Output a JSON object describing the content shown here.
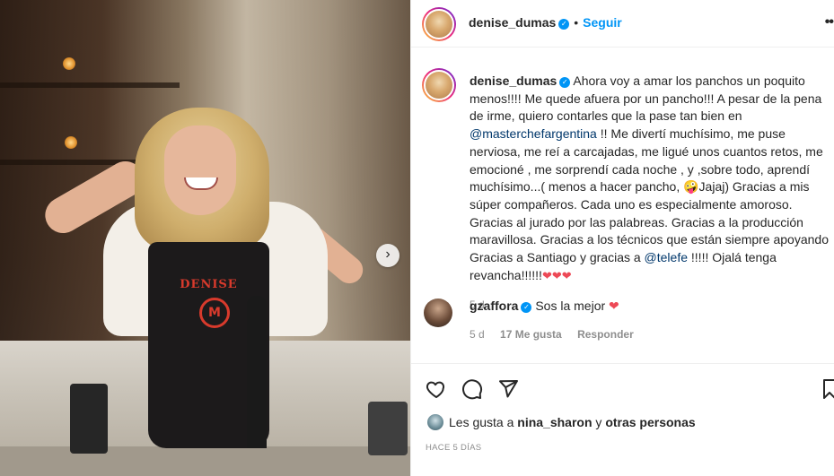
{
  "post": {
    "image_label_apron": "DENISE",
    "image_logo_text": "M",
    "next_icon": "chevron-right-icon"
  },
  "header": {
    "username": "denise_dumas",
    "dot": "•",
    "follow_label": "Seguir",
    "more_label": "••"
  },
  "caption": {
    "username": "denise_dumas",
    "text_1": " Ahora voy a amar los panchos un poquito menos!!!! Me quede afuera por un pancho!!! A pesar de la pena de irme, quiero contarles que la pase tan bien en ",
    "mention_1": "@masterchefargentina",
    "text_2": " !! Me divertí muchísimo, me puse nerviosa, me reí a carcajadas, me ligué unos cuantos retos, me emocioné , me sorprendí cada noche , y ,sobre todo, aprendí muchísimo...( menos a hacer pancho, ",
    "emoji": "🤪",
    "text_3": "Jajaj) Gracias a mis súper compañeros. Cada uno es especialmente amoroso. Gracias al jurado por las palabreas. Gracias a la producción maravillosa. Gracias a los técnicos que están siempre apoyando Gracias a Santiago y gracias a ",
    "mention_2": "@telefe",
    "text_4": " !!!!! Ojalá tenga revancha!!!!!!",
    "hearts": "❤❤❤",
    "time": "5 d"
  },
  "comment": {
    "username": "gzaffora",
    "text": "Sos la mejor",
    "heart": "❤",
    "time": "5 d",
    "likes": "17 Me gusta",
    "reply_label": "Responder"
  },
  "footer": {
    "likes_prefix": "Les gusta a ",
    "likes_user": "nina_sharon",
    "likes_mid": " y ",
    "likes_others": "otras personas",
    "date": "HACE 5 DÍAS"
  },
  "colors": {
    "accent": "#0095f6",
    "heart": "#ed4956",
    "mention": "#00376b"
  }
}
